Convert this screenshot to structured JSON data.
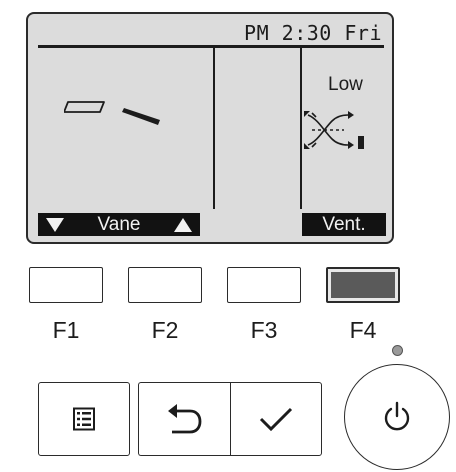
{
  "lcd": {
    "clock": "PM 2:30 Fri",
    "fan_speed": "Low",
    "f1_f2_label": "Vane",
    "f4_label": "Vent."
  },
  "function_keys": [
    "F1",
    "F2",
    "F3",
    "F4"
  ],
  "icons": {
    "vane": "vane-position-icon",
    "vent": "ventilation-icon",
    "vane_down": "triangle-down-icon",
    "vane_up": "triangle-up-icon",
    "menu": "menu-icon",
    "back": "return-arrow-icon",
    "confirm": "checkmark-icon",
    "power": "power-icon",
    "power_led": "power-led-icon"
  },
  "colors": {
    "lcd_background": "#dcdcdc",
    "lcd_text": "#1c1c1c",
    "tab_background": "#121212",
    "active_key": "#5a5a5a"
  }
}
